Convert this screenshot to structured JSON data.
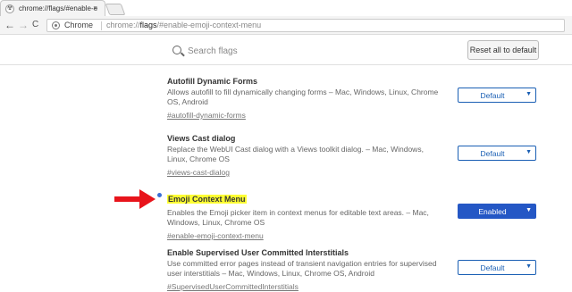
{
  "tab": {
    "title": "chrome://flags/#enable-e",
    "close": "×"
  },
  "toolbar": {
    "back": "←",
    "forward": "→",
    "reload": "C",
    "site_label": "Chrome",
    "url_prefix": "chrome://",
    "url_bold": "flags",
    "url_suffix": "/#enable-emoji-context-menu"
  },
  "header": {
    "search_placeholder": "Search flags",
    "reset_label": "Reset all to default"
  },
  "flags": [
    {
      "title": "Autofill Dynamic Forms",
      "description": "Allows autofill to fill dynamically changing forms – Mac, Windows, Linux, Chrome OS, Android",
      "link": "#autofill-dynamic-forms",
      "state": "Default",
      "highlighted": false
    },
    {
      "title": "Views Cast dialog",
      "description": "Replace the WebUI Cast dialog with a Views toolkit dialog. – Mac, Windows, Linux, Chrome OS",
      "link": "#views-cast-dialog",
      "state": "Default",
      "highlighted": false
    },
    {
      "title": "Emoji Context Menu",
      "description": "Enables the Emoji picker item in context menus for editable text areas. – Mac, Windows, Linux, Chrome OS",
      "link": "#enable-emoji-context-menu",
      "state": "Enabled",
      "highlighted": true
    },
    {
      "title": "Enable Supervised User Committed Interstitials",
      "description": "Use committed error pages instead of transient navigation entries for supervised user interstitials – Mac, Windows, Linux, Chrome OS, Android",
      "link": "#SupervisedUserCommittedInterstitials",
      "state": "Default",
      "highlighted": false
    }
  ],
  "colors": {
    "accent": "#2457c5",
    "highlight": "#ffff33",
    "arrow": "#e8141b"
  }
}
